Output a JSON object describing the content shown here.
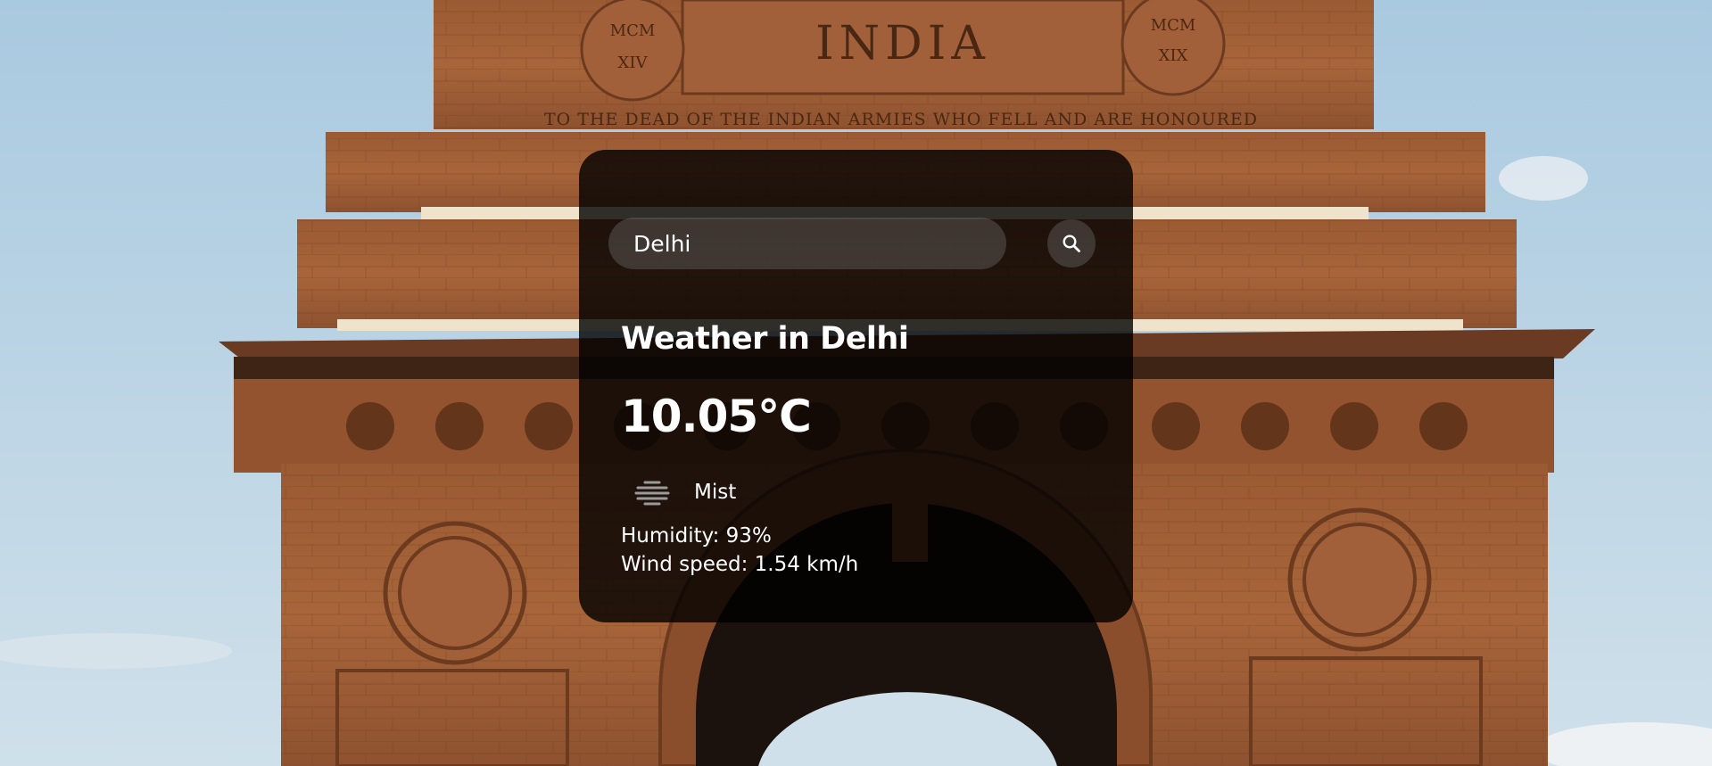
{
  "search": {
    "value": "Delhi",
    "button_icon": "search-icon"
  },
  "weather": {
    "title": "Weather in Delhi",
    "temperature": "10.05°C",
    "condition": "Mist",
    "condition_icon": "mist-icon",
    "humidity": "Humidity: 93%",
    "wind_speed": "Wind speed: 1.54 km/h"
  },
  "background": {
    "monument_inscription": "INDIA",
    "inscription_left": "MCM XIV",
    "inscription_right": "MCM XIX",
    "dedication_line": "TO THE DEAD OF THE INDIAN ARMIES WHO FELL AND ARE HONOURED",
    "sky_color": "#b9d3e4",
    "stone_color": "#a05f35"
  }
}
